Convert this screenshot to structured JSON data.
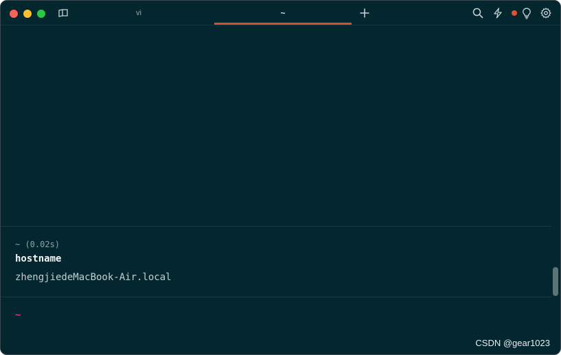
{
  "titlebar": {
    "tabs": [
      {
        "label": "vi",
        "active": false
      },
      {
        "label": "~",
        "active": true
      }
    ],
    "icons": [
      "tab-overview-icon",
      "new-tab-plus-icon",
      "search-icon",
      "lightning-icon",
      "status-dot-icon",
      "lightbulb-icon",
      "gear-icon"
    ],
    "accent_color": "#d9512c"
  },
  "block": {
    "meta": "~ (0.02s)",
    "command": "hostname",
    "output": "zhengjiedeMacBook-Air.local"
  },
  "prompt": {
    "text": "~"
  },
  "watermark": "CSDN @gear1023",
  "colors": {
    "background": "#04272f",
    "prompt": "#e0357c",
    "status_dot": "#e0532f"
  }
}
